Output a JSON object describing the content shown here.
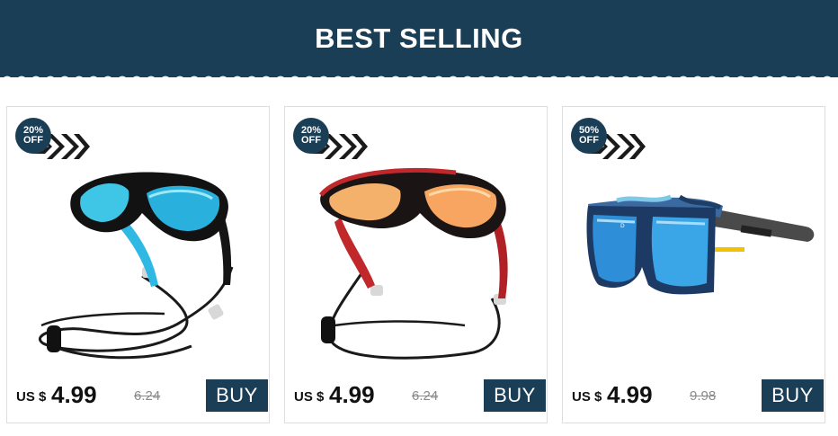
{
  "banner": {
    "title": "BEST SELLING"
  },
  "colors": {
    "navy": "#1b3e57",
    "cyan_lens": "#3fc6e6",
    "red_frame": "#c0282c",
    "mirror_gold": "#f4b16c",
    "blue_lens": "#2e8fd8"
  },
  "products": [
    {
      "badge_pct": "20%",
      "badge_off": "OFF",
      "currency": "US $",
      "price": "4.99",
      "old_price": "6.24",
      "buy_label": "BUY",
      "image": "black-blue sport sunglasses with cyan lenses and neck cord"
    },
    {
      "badge_pct": "20%",
      "badge_off": "OFF",
      "currency": "US $",
      "price": "4.99",
      "old_price": "6.24",
      "buy_label": "BUY",
      "image": "red-black sport sunglasses with orange mirror lenses and neck cord"
    },
    {
      "badge_pct": "50%",
      "badge_off": "OFF",
      "currency": "US $",
      "price": "4.99",
      "old_price": "9.98",
      "buy_label": "BUY",
      "image": "square camouflage sunglasses with blue mirror lenses"
    }
  ]
}
